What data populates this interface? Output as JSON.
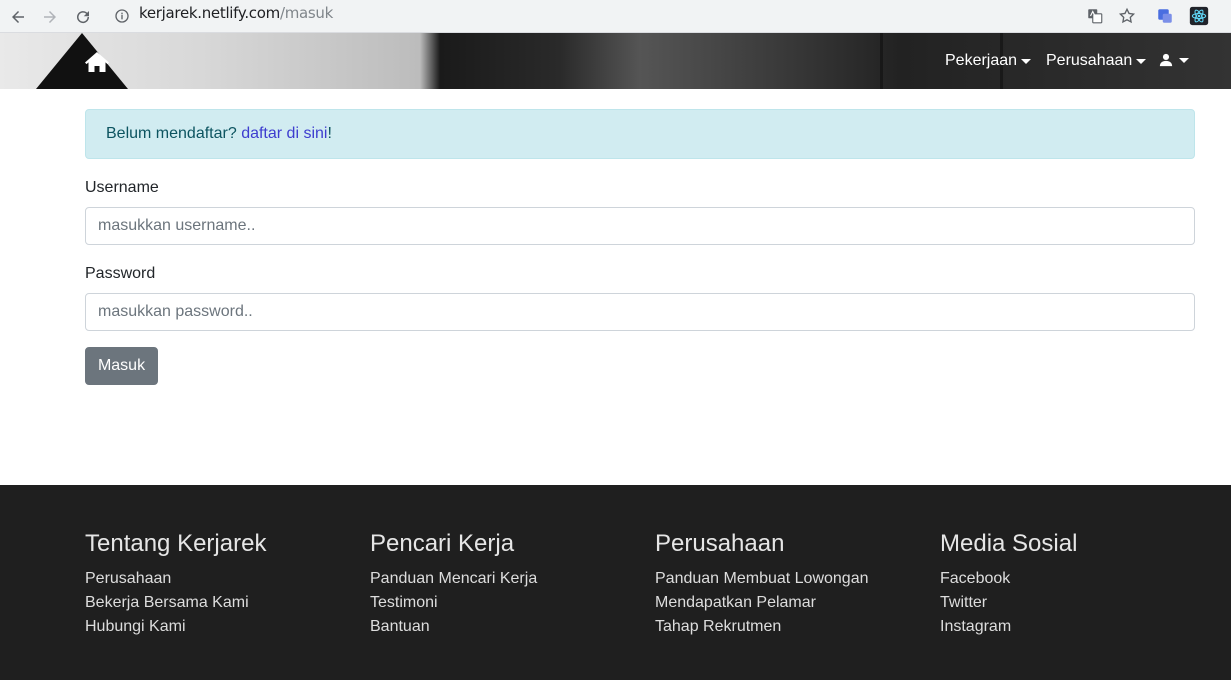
{
  "browser": {
    "url_host": "kerjarek.netlify.com",
    "url_path": "/masuk"
  },
  "navbar": {
    "home_icon": "home-icon",
    "menu": [
      {
        "label": "Pekerjaan"
      },
      {
        "label": "Perusahaan"
      }
    ],
    "user_icon": "user-icon"
  },
  "alert": {
    "prefix": "Belum mendaftar? ",
    "link_text": "daftar di sini",
    "suffix": "!"
  },
  "form": {
    "username_label": "Username",
    "username_placeholder": "masukkan username..",
    "password_label": "Password",
    "password_placeholder": "masukkan password..",
    "submit_label": "Masuk"
  },
  "footer": {
    "columns": [
      {
        "title": "Tentang Kerjarek",
        "items": [
          "Perusahaan",
          "Bekerja Bersama Kami",
          "Hubungi Kami"
        ]
      },
      {
        "title": "Pencari Kerja",
        "items": [
          "Panduan Mencari Kerja",
          "Testimoni",
          "Bantuan"
        ]
      },
      {
        "title": "Perusahaan",
        "items": [
          "Panduan Membuat Lowongan",
          "Mendapatkan Pelamar",
          "Tahap Rekrutmen"
        ]
      },
      {
        "title": "Media Sosial",
        "items": [
          "Facebook",
          "Twitter",
          "Instagram"
        ]
      }
    ]
  }
}
